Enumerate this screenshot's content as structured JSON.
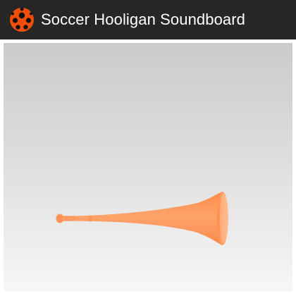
{
  "app": {
    "title": "Soccer Hooligan Soundboard",
    "icon": "soccer-ball-icon"
  },
  "colors": {
    "action_bar_bg": "#262626",
    "title_text": "#ffffff",
    "ball_orange": "#f04e0a",
    "ball_black": "#111111",
    "vuvuzela_orange": "#ff9a5e"
  },
  "main": {
    "sound_buttons": [
      {
        "icon": "vuvuzela-icon"
      }
    ]
  }
}
